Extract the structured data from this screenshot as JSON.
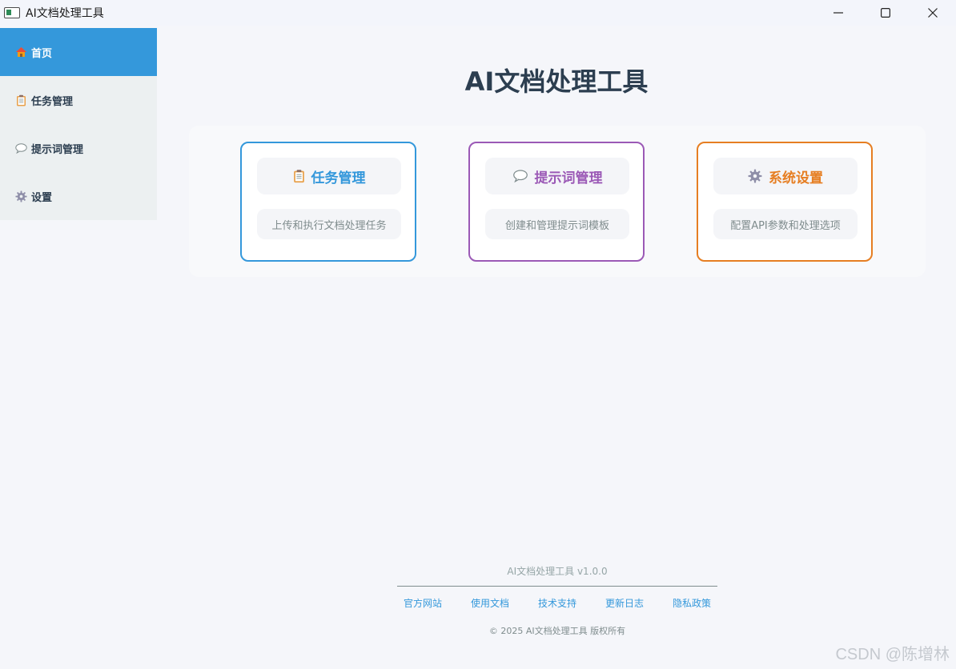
{
  "window": {
    "title": "AI文档处理工具"
  },
  "sidebar": {
    "items": [
      {
        "label": "首页",
        "icon": "house-icon",
        "active": true
      },
      {
        "label": "任务管理",
        "icon": "clipboard-icon",
        "active": false
      },
      {
        "label": "提示词管理",
        "icon": "speech-bubble-icon",
        "active": false
      },
      {
        "label": "设置",
        "icon": "gear-icon",
        "active": false
      }
    ]
  },
  "main": {
    "title": "AI文档处理工具",
    "cards": [
      {
        "title": "任务管理",
        "icon": "clipboard-icon",
        "description": "上传和执行文档处理任务",
        "color": "#3498db"
      },
      {
        "title": "提示词管理",
        "icon": "speech-bubble-icon",
        "description": "创建和管理提示词模板",
        "color": "#9b59b6"
      },
      {
        "title": "系统设置",
        "icon": "gear-icon",
        "description": "配置API参数和处理选项",
        "color": "#e67e22"
      }
    ]
  },
  "footer": {
    "version": "AI文档处理工具 v1.0.0",
    "links": [
      "官方网站",
      "使用文档",
      "技术支持",
      "更新日志",
      "隐私政策"
    ],
    "copyright": "© 2025 AI文档处理工具 版权所有"
  },
  "watermark": "CSDN @陈增林",
  "colors": {
    "accent": "#3498db",
    "sidebar_bg": "#ecf0f1",
    "text_dark": "#2c3e50"
  }
}
